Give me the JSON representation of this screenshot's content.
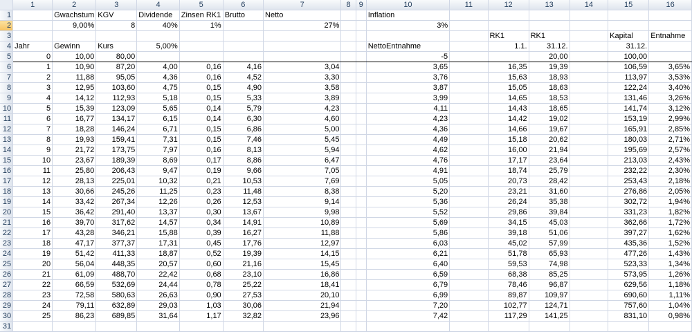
{
  "columns": [
    "1",
    "2",
    "3",
    "4",
    "5",
    "6",
    "7",
    "8",
    "9",
    "10",
    "11",
    "12",
    "13",
    "14",
    "15",
    "16"
  ],
  "selected_row": 2,
  "rows": [
    {
      "n": "1",
      "cells": [
        "",
        "Gwachstum",
        "KGV",
        "Dividende",
        "Zinsen RK1",
        "Brutto",
        "Netto",
        "",
        "",
        "Inflation",
        "",
        "",
        "",
        "",
        "",
        ""
      ]
    },
    {
      "n": "2",
      "cells": [
        "",
        "9,00%",
        "8",
        "40%",
        "1%",
        "",
        "27%",
        "",
        "",
        "3%",
        "",
        "",
        "",
        "",
        "",
        ""
      ]
    },
    {
      "n": "3",
      "cells": [
        "",
        "",
        "",
        "",
        "",
        "",
        "",
        "",
        "",
        "",
        "",
        "RK1",
        "RK1",
        "",
        "Kapital",
        "Entnahme"
      ]
    },
    {
      "n": "4",
      "cells": [
        "Jahr",
        "Gewinn",
        "Kurs",
        "5,00%",
        "",
        "",
        "",
        "",
        "",
        "NettoEntnahme",
        "",
        "1.1.",
        "31.12.",
        "",
        "31.12.",
        ""
      ]
    },
    {
      "n": "5",
      "cells": [
        "0",
        "10,00",
        "80,00",
        "",
        "",
        "",
        "",
        "",
        "",
        "-5",
        "",
        "",
        "20,00",
        "",
        "100,00",
        ""
      ]
    },
    {
      "n": "6",
      "cells": [
        "1",
        "10,90",
        "87,20",
        "4,00",
        "0,16",
        "4,16",
        "3,04",
        "",
        "",
        "3,65",
        "",
        "16,35",
        "19,39",
        "",
        "106,59",
        "3,65%"
      ]
    },
    {
      "n": "7",
      "cells": [
        "2",
        "11,88",
        "95,05",
        "4,36",
        "0,16",
        "4,52",
        "3,30",
        "",
        "",
        "3,76",
        "",
        "15,63",
        "18,93",
        "",
        "113,97",
        "3,53%"
      ]
    },
    {
      "n": "8",
      "cells": [
        "3",
        "12,95",
        "103,60",
        "4,75",
        "0,15",
        "4,90",
        "3,58",
        "",
        "",
        "3,87",
        "",
        "15,05",
        "18,63",
        "",
        "122,24",
        "3,40%"
      ]
    },
    {
      "n": "9",
      "cells": [
        "4",
        "14,12",
        "112,93",
        "5,18",
        "0,15",
        "5,33",
        "3,89",
        "",
        "",
        "3,99",
        "",
        "14,65",
        "18,53",
        "",
        "131,46",
        "3,26%"
      ]
    },
    {
      "n": "10",
      "cells": [
        "5",
        "15,39",
        "123,09",
        "5,65",
        "0,14",
        "5,79",
        "4,23",
        "",
        "",
        "4,11",
        "",
        "14,43",
        "18,65",
        "",
        "141,74",
        "3,12%"
      ]
    },
    {
      "n": "11",
      "cells": [
        "6",
        "16,77",
        "134,17",
        "6,15",
        "0,14",
        "6,30",
        "4,60",
        "",
        "",
        "4,23",
        "",
        "14,42",
        "19,02",
        "",
        "153,19",
        "2,99%"
      ]
    },
    {
      "n": "12",
      "cells": [
        "7",
        "18,28",
        "146,24",
        "6,71",
        "0,15",
        "6,86",
        "5,00",
        "",
        "",
        "4,36",
        "",
        "14,66",
        "19,67",
        "",
        "165,91",
        "2,85%"
      ]
    },
    {
      "n": "13",
      "cells": [
        "8",
        "19,93",
        "159,41",
        "7,31",
        "0,15",
        "7,46",
        "5,45",
        "",
        "",
        "4,49",
        "",
        "15,18",
        "20,62",
        "",
        "180,03",
        "2,71%"
      ]
    },
    {
      "n": "14",
      "cells": [
        "9",
        "21,72",
        "173,75",
        "7,97",
        "0,16",
        "8,13",
        "5,94",
        "",
        "",
        "4,62",
        "",
        "16,00",
        "21,94",
        "",
        "195,69",
        "2,57%"
      ]
    },
    {
      "n": "15",
      "cells": [
        "10",
        "23,67",
        "189,39",
        "8,69",
        "0,17",
        "8,86",
        "6,47",
        "",
        "",
        "4,76",
        "",
        "17,17",
        "23,64",
        "",
        "213,03",
        "2,43%"
      ]
    },
    {
      "n": "16",
      "cells": [
        "11",
        "25,80",
        "206,43",
        "9,47",
        "0,19",
        "9,66",
        "7,05",
        "",
        "",
        "4,91",
        "",
        "18,74",
        "25,79",
        "",
        "232,22",
        "2,30%"
      ]
    },
    {
      "n": "17",
      "cells": [
        "12",
        "28,13",
        "225,01",
        "10,32",
        "0,21",
        "10,53",
        "7,69",
        "",
        "",
        "5,05",
        "",
        "20,73",
        "28,42",
        "",
        "253,43",
        "2,18%"
      ]
    },
    {
      "n": "18",
      "cells": [
        "13",
        "30,66",
        "245,26",
        "11,25",
        "0,23",
        "11,48",
        "8,38",
        "",
        "",
        "5,20",
        "",
        "23,21",
        "31,60",
        "",
        "276,86",
        "2,05%"
      ]
    },
    {
      "n": "19",
      "cells": [
        "14",
        "33,42",
        "267,34",
        "12,26",
        "0,26",
        "12,53",
        "9,14",
        "",
        "",
        "5,36",
        "",
        "26,24",
        "35,38",
        "",
        "302,72",
        "1,94%"
      ]
    },
    {
      "n": "20",
      "cells": [
        "15",
        "36,42",
        "291,40",
        "13,37",
        "0,30",
        "13,67",
        "9,98",
        "",
        "",
        "5,52",
        "",
        "29,86",
        "39,84",
        "",
        "331,23",
        "1,82%"
      ]
    },
    {
      "n": "21",
      "cells": [
        "16",
        "39,70",
        "317,62",
        "14,57",
        "0,34",
        "14,91",
        "10,89",
        "",
        "",
        "5,69",
        "",
        "34,15",
        "45,03",
        "",
        "362,66",
        "1,72%"
      ]
    },
    {
      "n": "22",
      "cells": [
        "17",
        "43,28",
        "346,21",
        "15,88",
        "0,39",
        "16,27",
        "11,88",
        "",
        "",
        "5,86",
        "",
        "39,18",
        "51,06",
        "",
        "397,27",
        "1,62%"
      ]
    },
    {
      "n": "23",
      "cells": [
        "18",
        "47,17",
        "377,37",
        "17,31",
        "0,45",
        "17,76",
        "12,97",
        "",
        "",
        "6,03",
        "",
        "45,02",
        "57,99",
        "",
        "435,36",
        "1,52%"
      ]
    },
    {
      "n": "24",
      "cells": [
        "19",
        "51,42",
        "411,33",
        "18,87",
        "0,52",
        "19,39",
        "14,15",
        "",
        "",
        "6,21",
        "",
        "51,78",
        "65,93",
        "",
        "477,26",
        "1,43%"
      ]
    },
    {
      "n": "25",
      "cells": [
        "20",
        "56,04",
        "448,35",
        "20,57",
        "0,60",
        "21,16",
        "15,45",
        "",
        "",
        "6,40",
        "",
        "59,53",
        "74,98",
        "",
        "523,33",
        "1,34%"
      ]
    },
    {
      "n": "26",
      "cells": [
        "21",
        "61,09",
        "488,70",
        "22,42",
        "0,68",
        "23,10",
        "16,86",
        "",
        "",
        "6,59",
        "",
        "68,38",
        "85,25",
        "",
        "573,95",
        "1,26%"
      ]
    },
    {
      "n": "27",
      "cells": [
        "22",
        "66,59",
        "532,69",
        "24,44",
        "0,78",
        "25,22",
        "18,41",
        "",
        "",
        "6,79",
        "",
        "78,46",
        "96,87",
        "",
        "629,56",
        "1,18%"
      ]
    },
    {
      "n": "28",
      "cells": [
        "23",
        "72,58",
        "580,63",
        "26,63",
        "0,90",
        "27,53",
        "20,10",
        "",
        "",
        "6,99",
        "",
        "89,87",
        "109,97",
        "",
        "690,60",
        "1,11%"
      ]
    },
    {
      "n": "29",
      "cells": [
        "24",
        "79,11",
        "632,89",
        "29,03",
        "1,03",
        "30,06",
        "21,94",
        "",
        "",
        "7,20",
        "",
        "102,77",
        "124,71",
        "",
        "757,60",
        "1,04%"
      ]
    },
    {
      "n": "30",
      "cells": [
        "25",
        "86,23",
        "689,85",
        "31,64",
        "1,17",
        "32,82",
        "23,96",
        "",
        "",
        "7,42",
        "",
        "117,29",
        "141,25",
        "",
        "831,10",
        "0,98%"
      ]
    },
    {
      "n": "31",
      "cells": [
        "",
        "",
        "",
        "",
        "",
        "",
        "",
        "",
        "",
        "",
        "",
        "",
        "",
        "",
        "",
        ""
      ]
    }
  ]
}
